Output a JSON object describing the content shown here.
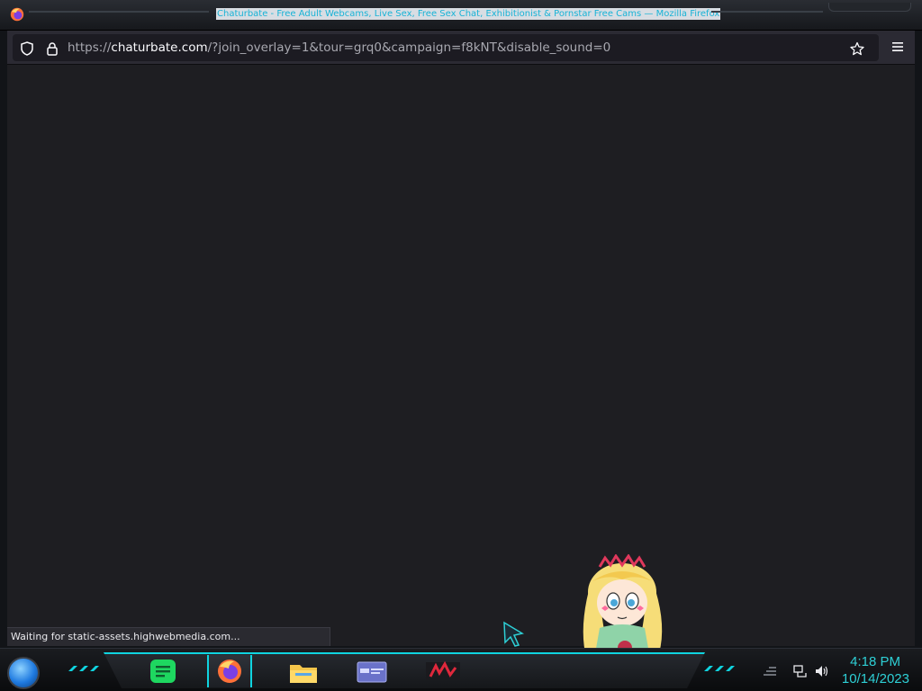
{
  "window": {
    "title": "Chaturbate - Free Adult Webcams, Live Sex, Free Sex Chat, Exhibitionist & Pornstar Free Cams — Mozilla Firefox"
  },
  "navbar": {
    "url_prefix": "https://",
    "url_host": "chaturbate.com",
    "url_rest": "/?join_overlay=1&tour=grq0&campaign=f8kNT&disable_sound=0",
    "icons": [
      "shield-icon",
      "lock-icon",
      "bookmark-star-icon",
      "menu-icon"
    ]
  },
  "statusbar": {
    "text": "Waiting for static-assets.highwebmedia.com..."
  },
  "taskbar": {
    "apps": [
      "spotify",
      "firefox",
      "file-explorer",
      "app-window",
      "media-app"
    ],
    "clock_time": "4:18 PM",
    "clock_date": "10/14/2023"
  },
  "colors": {
    "accent": "#0fd4e0",
    "clock": "#2ed0d6",
    "content_bg": "#1e1e22"
  }
}
